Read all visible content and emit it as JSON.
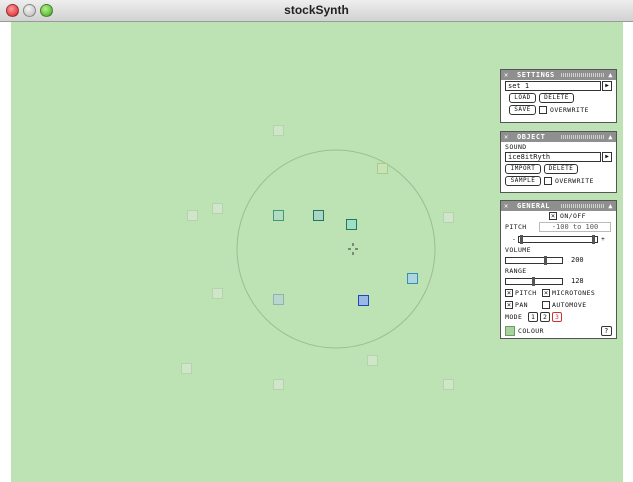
{
  "window": {
    "title": "stockSynth"
  },
  "titlebar": {
    "close_glyph": "",
    "min_glyph": "",
    "max_glyph": ""
  },
  "colors": {
    "canvas": "#bde2b4",
    "panel_header": "#8f8f8f",
    "selected_blue": "#3a56c8",
    "selected_teal": "#2a9d8f",
    "ghost": "#a9c9a1"
  },
  "settings": {
    "header": "SETTINGS",
    "set_value": "set 1",
    "load_label": "LOAD",
    "delete_label": "DELETE",
    "save_label": "SAVE",
    "overwrite_label": "OVERWRITE"
  },
  "object": {
    "header": "OBJECT",
    "sound_label": "SOUND",
    "sound_value": "ice8itRyth",
    "import_label": "IMPORT",
    "delete_label": "DELETE",
    "sample_label": "SAMPLE",
    "overwrite_label": "OVERWRITE"
  },
  "general": {
    "header": "GENERAL",
    "onoff_label": "ON/OFF",
    "pitch_label": "PITCH",
    "pitch_range": "-100 to 100",
    "minus": "-",
    "plus": "+",
    "volume_label": "VOLUME",
    "volume_value": "200",
    "range_label": "RANGE",
    "range_value": "128",
    "pitch_check": "PITCH",
    "microtones_check": "MICROTONES",
    "pan_check": "PAN",
    "automove_check": "AUTOMOVE",
    "mode_label": "MODE",
    "mode_1": "1",
    "mode_2": "2",
    "mode_3": "3",
    "colour_label": "COLOUR",
    "help_label": "?"
  }
}
